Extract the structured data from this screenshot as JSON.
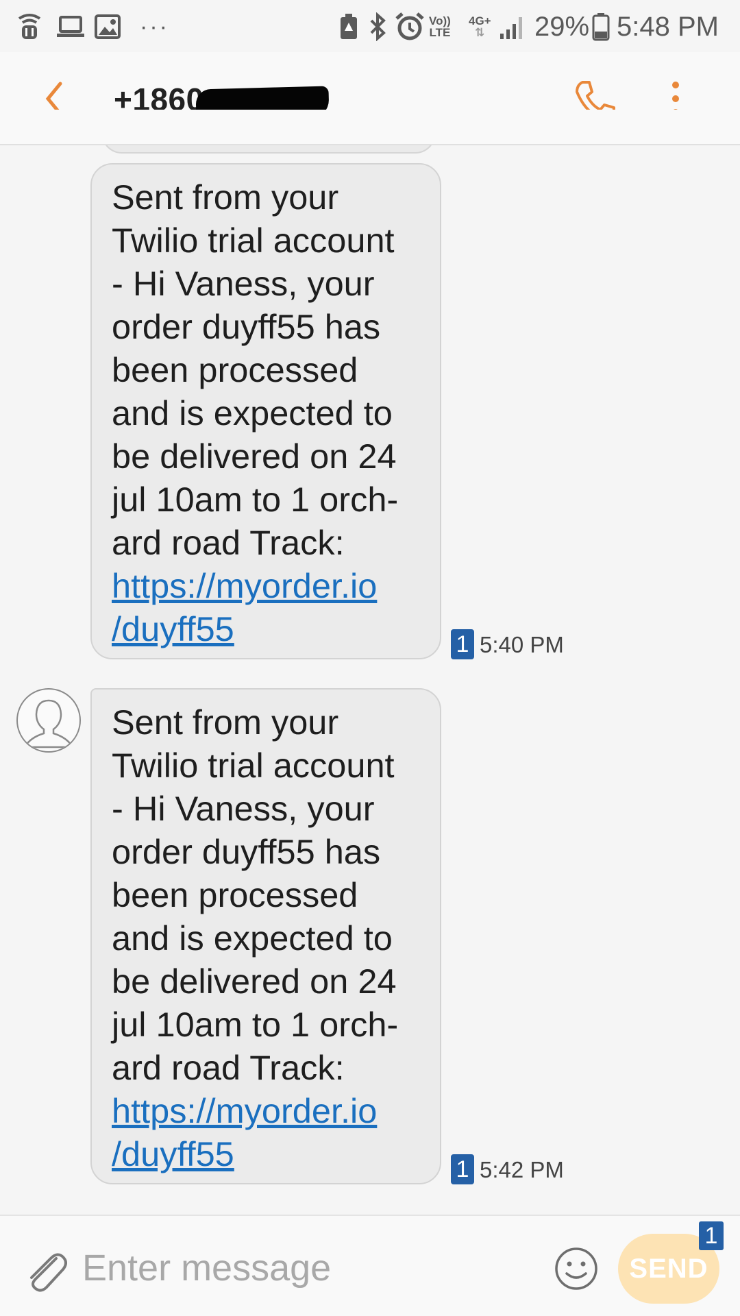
{
  "status_bar": {
    "icons_left": [
      "wifi-calling-icon",
      "laptop-icon",
      "gallery-icon",
      "more-notifications-icon"
    ],
    "more_dots": "···",
    "volte_top": "Vo))",
    "volte_bottom": "LTE",
    "network": "4G+",
    "battery_percent": "29%",
    "time": "5:48 PM"
  },
  "header": {
    "contact": "+1860",
    "accent_color": "#e9883a"
  },
  "messages": [
    {
      "body": "Sent from your\nTwilio trial account\n- Hi Vaness, your\norder duyff55 has\nbeen processed\nand is expected to\nbe delivered on 24\njul 10am to 1 orch-\nard road Track:",
      "link": "https://myorder.io\n/duyff55",
      "sim": "1",
      "time": "5:40 PM"
    },
    {
      "body": "Sent from your\nTwilio trial account\n- Hi Vaness, your\norder duyff55 has\nbeen processed\nand is expected to\nbe delivered on 24\njul 10am to 1 orch-\nard road Track:",
      "link": "https://myorder.io\n/duyff55",
      "sim": "1",
      "time": "5:42 PM"
    }
  ],
  "composer": {
    "placeholder": "Enter message",
    "send_label": "SEND",
    "sim": "1"
  }
}
